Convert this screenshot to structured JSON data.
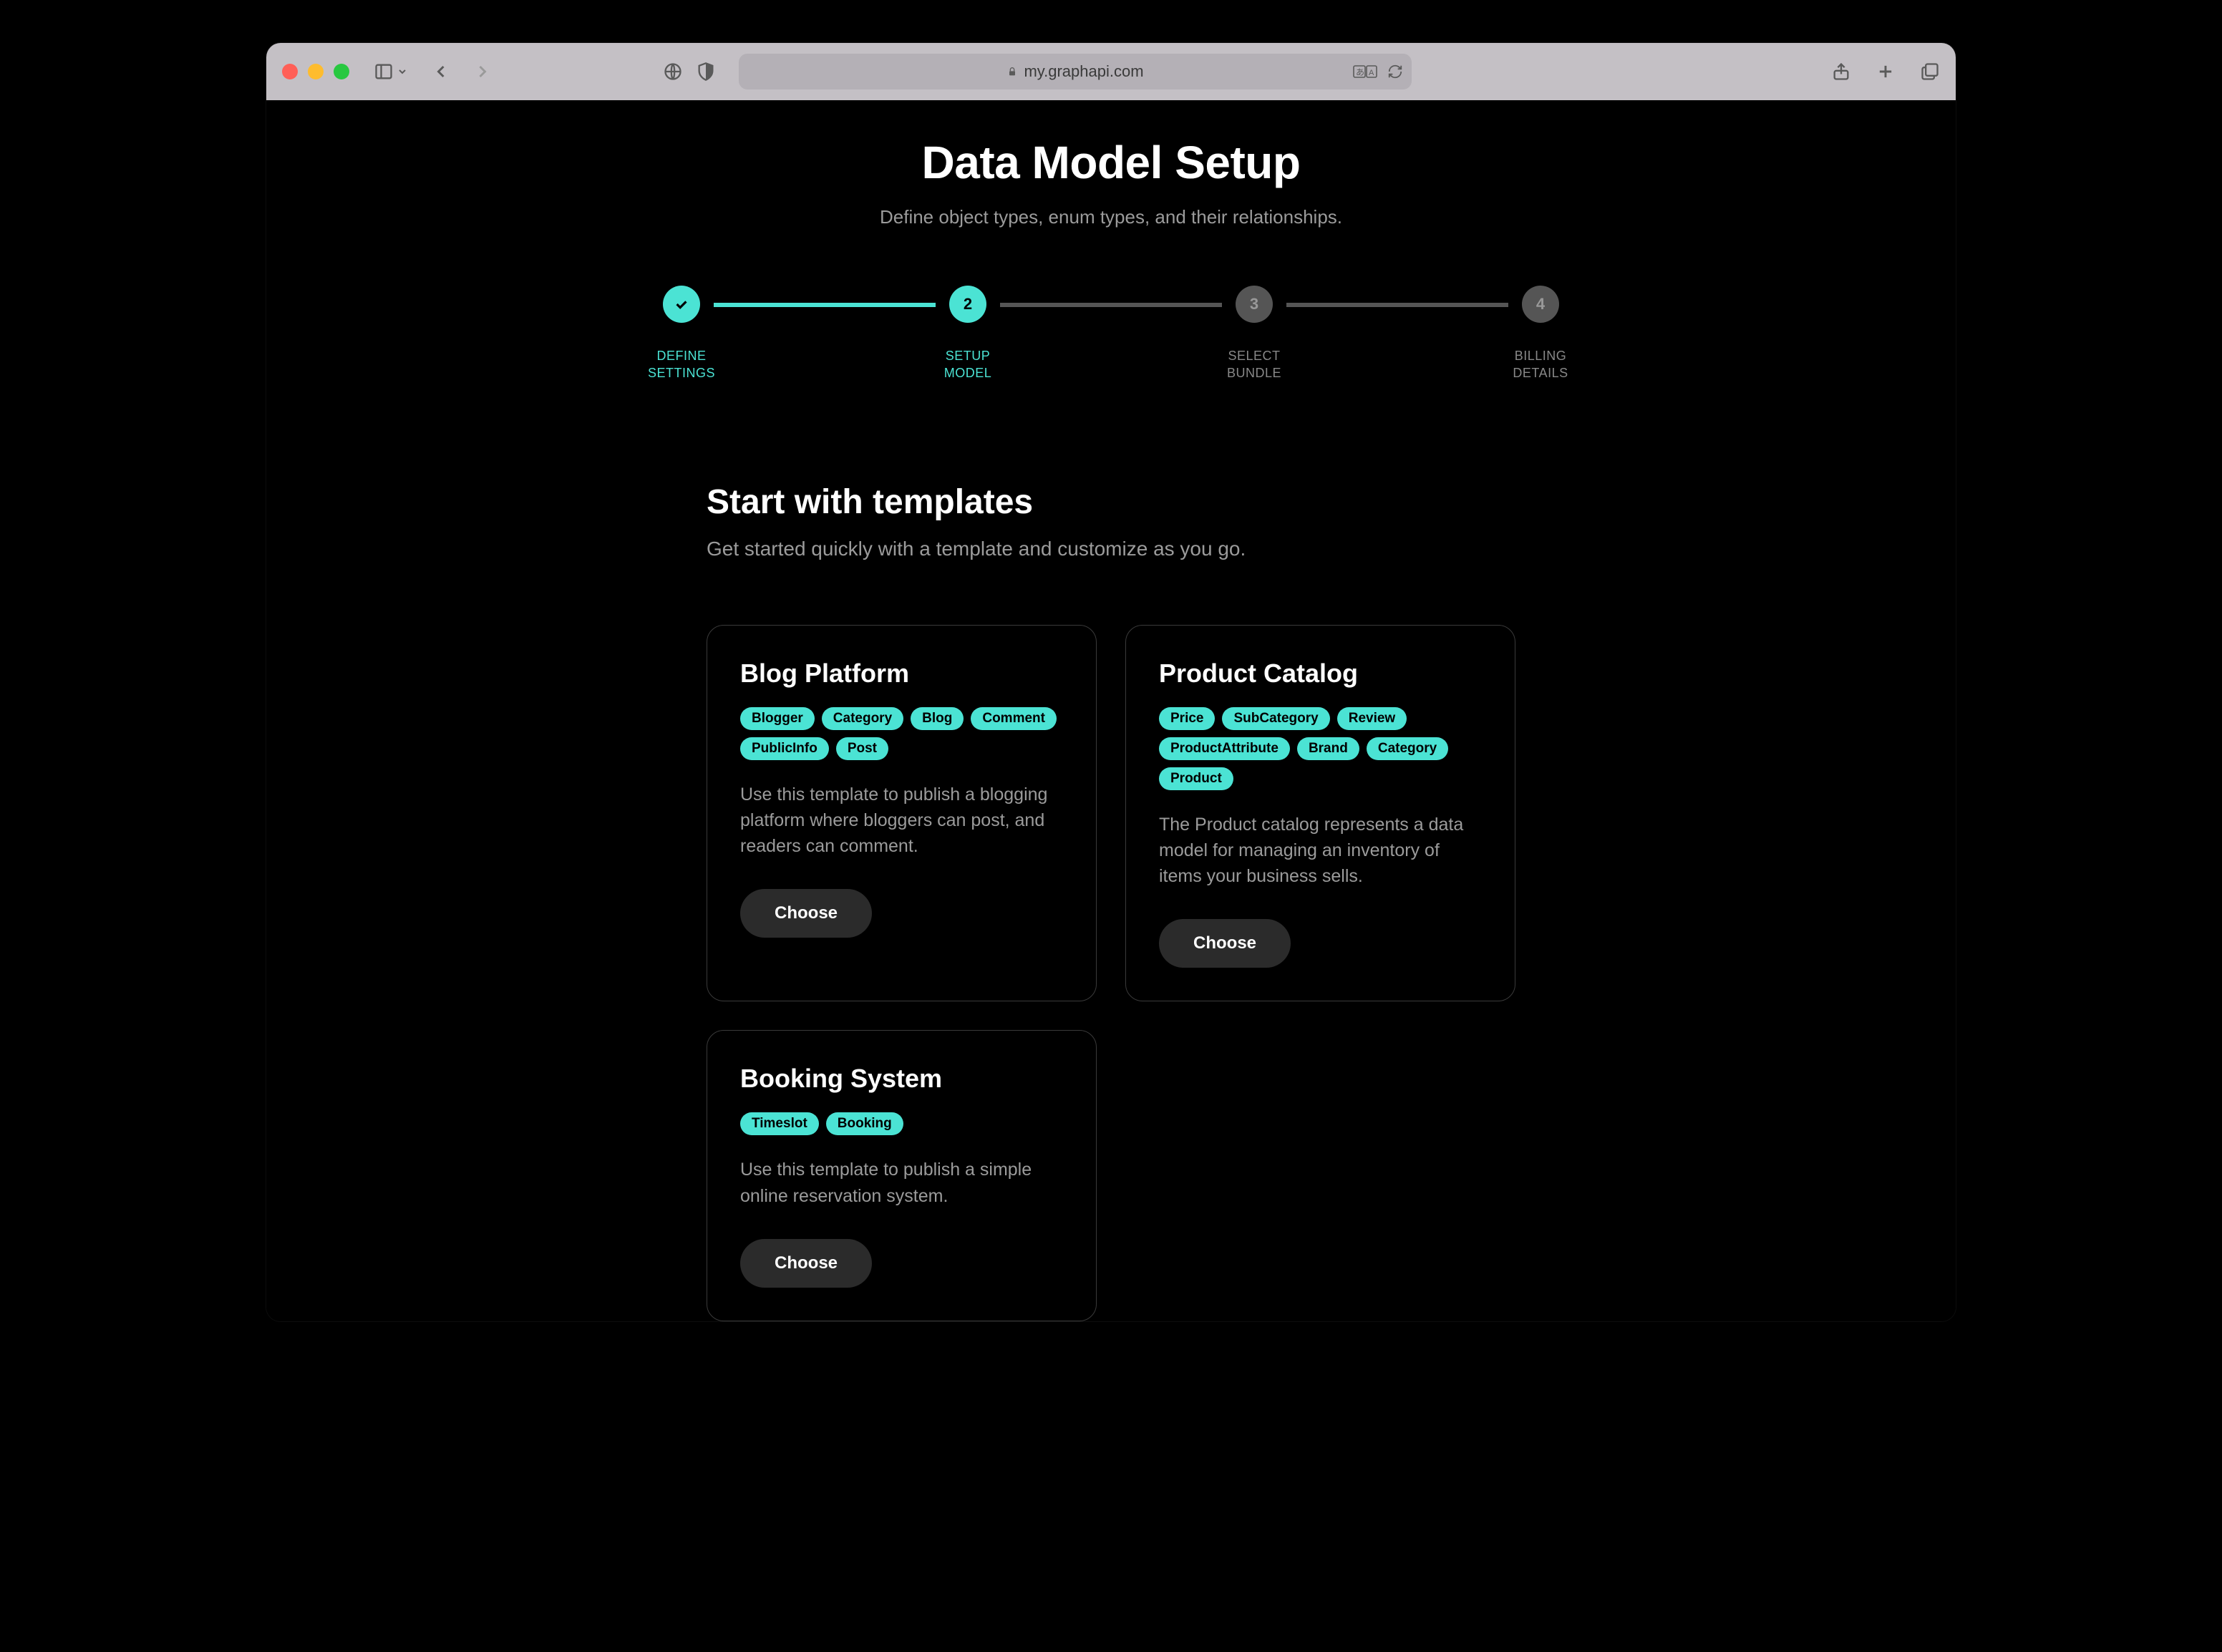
{
  "browser": {
    "url": "my.graphapi.com"
  },
  "page": {
    "title": "Data Model Setup",
    "subtitle": "Define object types, enum types, and their relationships."
  },
  "stepper": {
    "steps": [
      {
        "label_line1": "DEFINE",
        "label_line2": "SETTINGS",
        "state": "done"
      },
      {
        "num": "2",
        "label_line1": "SETUP",
        "label_line2": "MODEL",
        "state": "active"
      },
      {
        "num": "3",
        "label_line1": "SELECT",
        "label_line2": "BUNDLE",
        "state": "pending"
      },
      {
        "num": "4",
        "label_line1": "BILLING",
        "label_line2": "DETAILS",
        "state": "pending"
      }
    ]
  },
  "section": {
    "title": "Start with templates",
    "subtitle": "Get started quickly with a template and customize as you go."
  },
  "cards": [
    {
      "title": "Blog Platform",
      "tags": [
        "Blogger",
        "Category",
        "Blog",
        "Comment",
        "PublicInfo",
        "Post"
      ],
      "desc": "Use this template to publish a blogging platform where bloggers can post, and readers can comment.",
      "button": "Choose"
    },
    {
      "title": "Product Catalog",
      "tags": [
        "Price",
        "SubCategory",
        "Review",
        "ProductAttribute",
        "Brand",
        "Category",
        "Product"
      ],
      "desc": "The Product catalog represents a data model for managing an inventory of items your business sells.",
      "button": "Choose"
    },
    {
      "title": "Booking System",
      "tags": [
        "Timeslot",
        "Booking"
      ],
      "desc": "Use this template to publish a simple online reservation system.",
      "button": "Choose"
    }
  ]
}
